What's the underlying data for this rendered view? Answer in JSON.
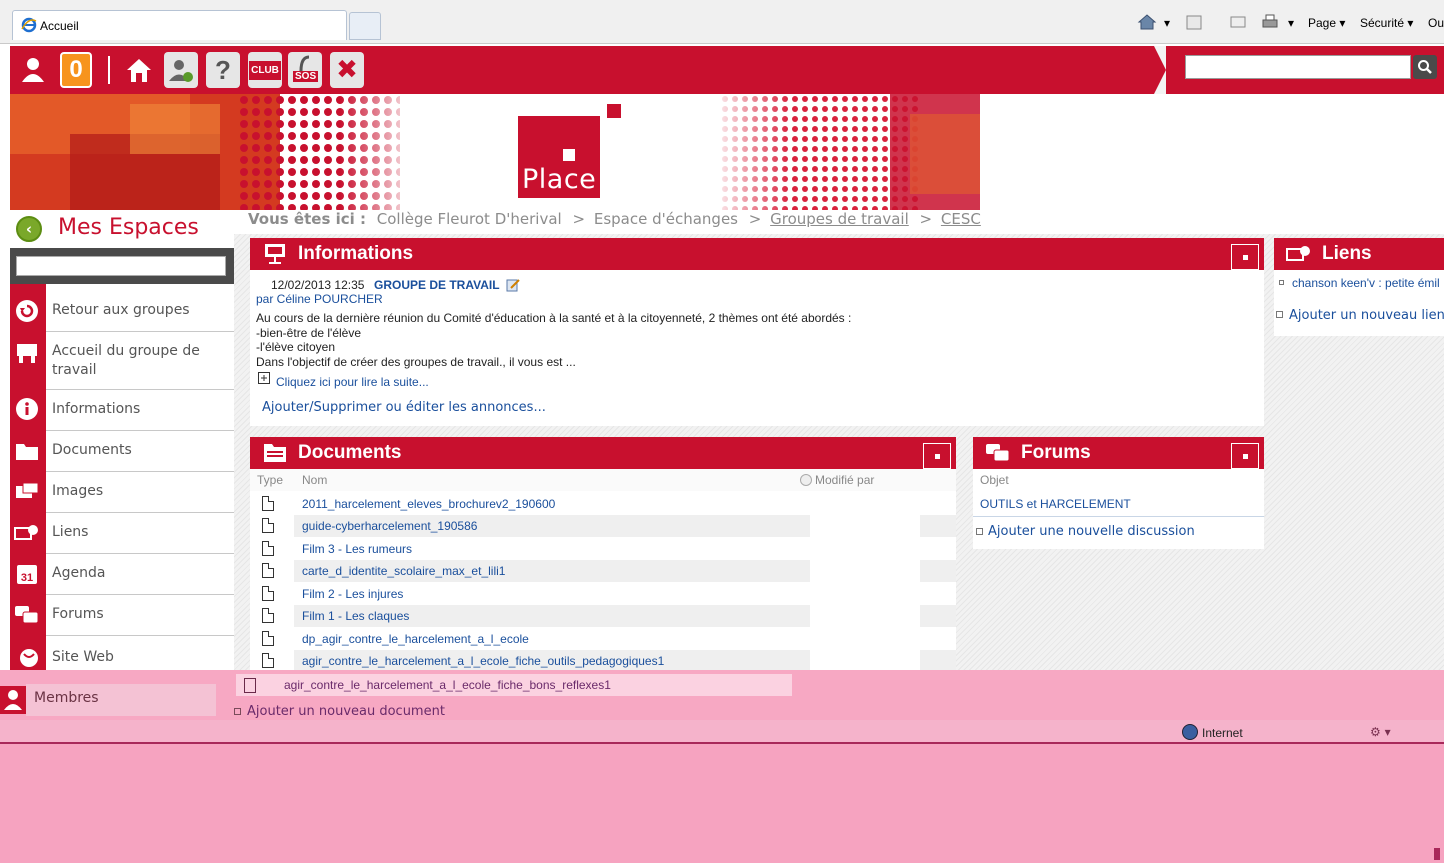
{
  "browser": {
    "tab_title": "Accueil",
    "commands": {
      "page": "Page",
      "security": "Sécurité",
      "tools_partial": "Ou"
    },
    "status": {
      "zone": "Internet"
    }
  },
  "toolbar": {
    "notification_count": "0",
    "club_label": "CLUB",
    "sos_label": "SOS",
    "search_value": ""
  },
  "banner": {
    "logo_text": "Place"
  },
  "sidebar": {
    "title": "Mes Espaces",
    "search_value": "",
    "items": [
      {
        "label": "Retour aux groupes"
      },
      {
        "label": "Accueil du groupe de travail"
      },
      {
        "label": "Informations"
      },
      {
        "label": "Documents"
      },
      {
        "label": "Images"
      },
      {
        "label": "Liens"
      },
      {
        "label": "Agenda"
      },
      {
        "label": "Forums"
      },
      {
        "label": "Site Web"
      },
      {
        "label": "Membres"
      }
    ]
  },
  "breadcrumb": {
    "prefix": "Vous êtes ici :",
    "items": [
      "Collège Fleurot D'herival",
      "Espace d'échanges",
      "Groupes de travail",
      "CESC"
    ],
    "separator": ">"
  },
  "informations": {
    "title": "Informations",
    "post": {
      "datetime": "12/02/2013 12:35",
      "group": "GROUPE DE TRAVAIL",
      "author": "par Céline POURCHER",
      "lines": [
        "Au cours de la dernière réunion du Comité d'éducation à la santé et à la citoyenneté, 2 thèmes ont été abordés :",
        "-bien-être de l'élève",
        "-l'élève citoyen",
        "Dans l'objectif de créer des groupes de travail., il vous est ..."
      ],
      "read_more": "Cliquez ici pour lire la suite..."
    },
    "manage_link": "Ajouter/Supprimer ou éditer les annonces..."
  },
  "liens": {
    "title": "Liens",
    "items": [
      "chanson keen'v : petite émil"
    ],
    "add_link": "Ajouter un nouveau lien"
  },
  "documents": {
    "title": "Documents",
    "columns": {
      "type": "Type",
      "name": "Nom",
      "modified_by": "Modifié par"
    },
    "rows": [
      "2011_harcelement_eleves_brochurev2_190600",
      "guide-cyberharcelement_190586",
      "Film 3 - Les rumeurs",
      "carte_d_identite_scolaire_max_et_lili1",
      "Film 2 - Les injures",
      "Film 1 - Les claques",
      "dp_agir_contre_le_harcelement_a_l_ecole",
      "agir_contre_le_harcelement_a_l_ecole_fiche_outils_pedagogiques1",
      "agir_contre_le_harcelement_a_l_ecole_fiche_bons_reflexes1"
    ],
    "add_link": "Ajouter un nouveau document"
  },
  "forums": {
    "title": "Forums",
    "column": "Objet",
    "items": [
      "OUTILS et HARCELEMENT"
    ],
    "add_link": "Ajouter une nouvelle discussion"
  },
  "colors": {
    "brand_red": "#c8102e",
    "link_blue": "#1a4f9c",
    "overlay_pink": "#f7a8c3"
  }
}
